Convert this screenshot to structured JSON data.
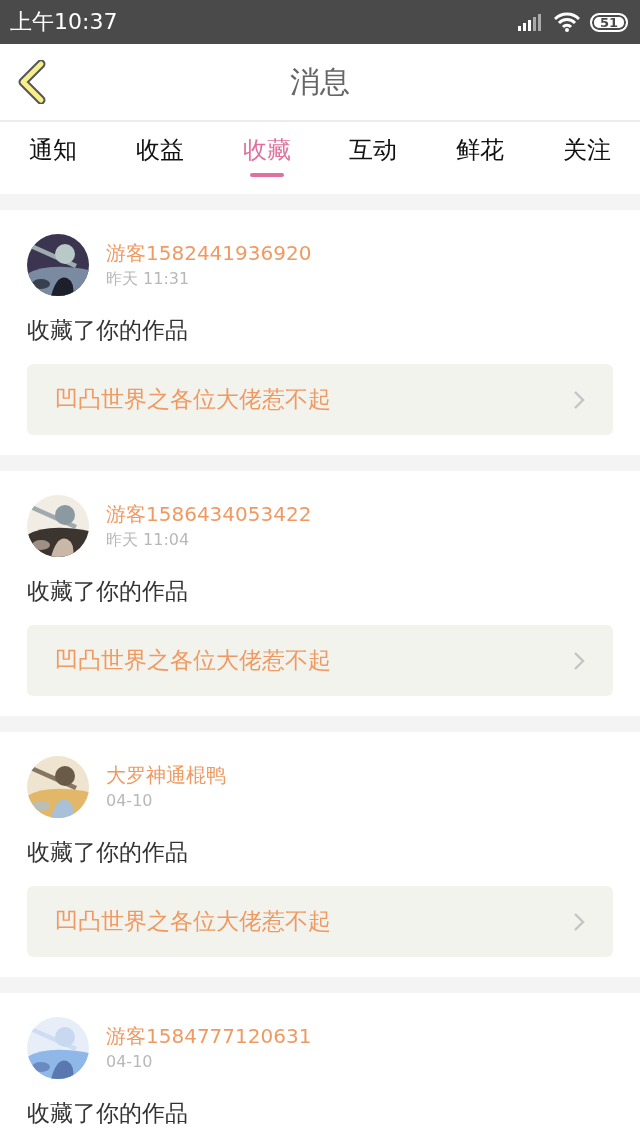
{
  "status_bar": {
    "time": "上午10:37",
    "battery": "51"
  },
  "header": {
    "title": "消息"
  },
  "tabs": [
    {
      "label": "通知",
      "selected": false
    },
    {
      "label": "收益",
      "selected": false
    },
    {
      "label": "收藏",
      "selected": true
    },
    {
      "label": "互动",
      "selected": false
    },
    {
      "label": "鲜花",
      "selected": false
    },
    {
      "label": "关注",
      "selected": false
    }
  ],
  "messages": [
    {
      "user": "游客1582441936920",
      "time": "昨天 11:31",
      "text": "收藏了你的作品",
      "work": "凹凸世界之各位大佬惹不起"
    },
    {
      "user": "游客1586434053422",
      "time": "昨天 11:04",
      "text": "收藏了你的作品",
      "work": "凹凸世界之各位大佬惹不起"
    },
    {
      "user": "大罗神通棍鸭",
      "time": "04-10",
      "text": "收藏了你的作品",
      "work": "凹凸世界之各位大佬惹不起"
    },
    {
      "user": "游客1584777120631",
      "time": "04-10",
      "text": "收藏了你的作品"
    }
  ]
}
